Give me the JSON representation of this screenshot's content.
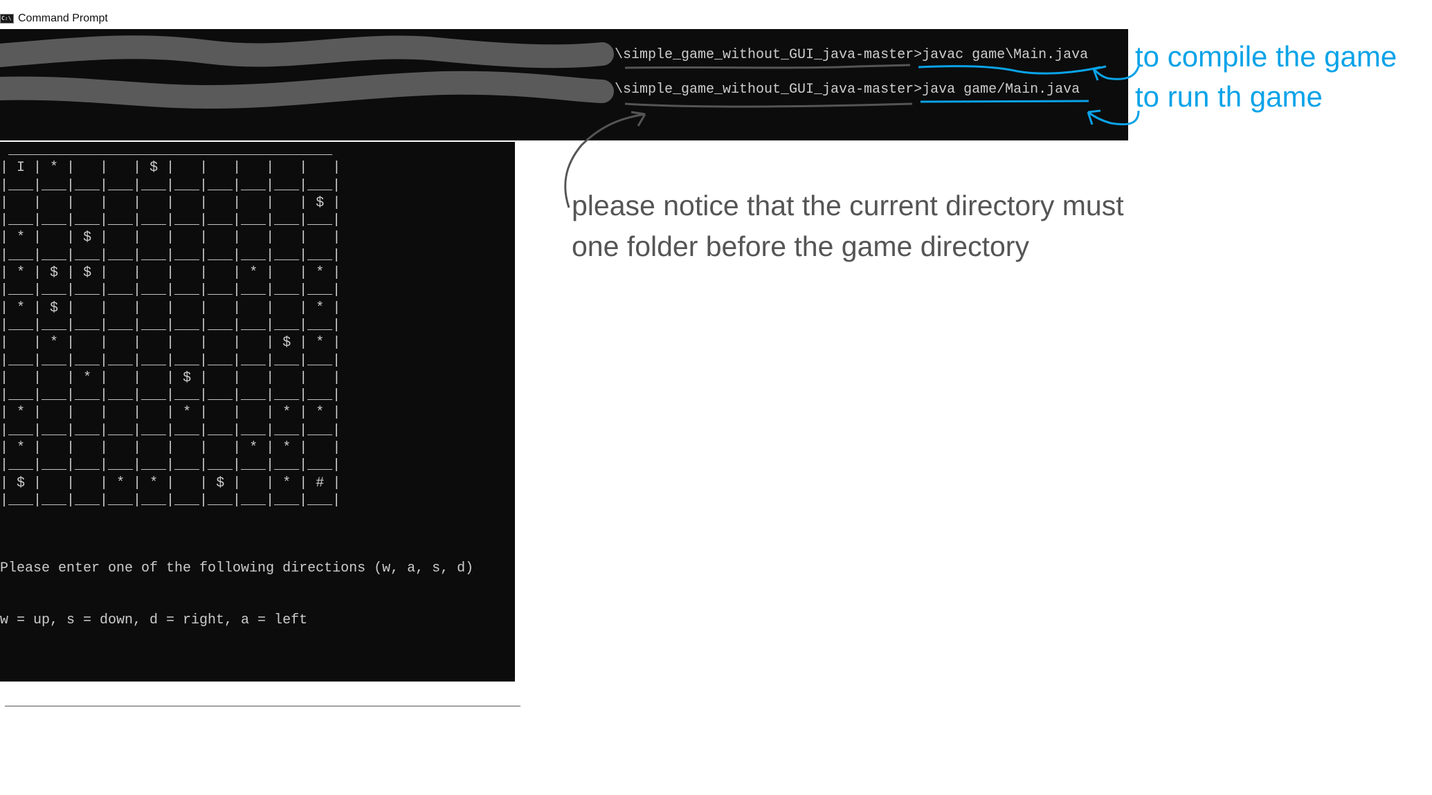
{
  "window": {
    "title": "Command Prompt",
    "icon": "cmd-icon",
    "icon_text": "C:\\"
  },
  "terminal": {
    "commands": [
      {
        "path": "\\simple_game_without_GUI_java-master>",
        "command": "javac game\\Main.java"
      },
      {
        "path": "\\simple_game_without_GUI_java-master>",
        "command": "java game/Main.java"
      }
    ],
    "grid": [
      [
        "I",
        "*",
        " ",
        " ",
        "$",
        " ",
        " ",
        " ",
        " ",
        " "
      ],
      [
        " ",
        " ",
        " ",
        " ",
        " ",
        " ",
        " ",
        " ",
        " ",
        "$"
      ],
      [
        "*",
        " ",
        "$",
        " ",
        " ",
        " ",
        " ",
        " ",
        " ",
        " "
      ],
      [
        "*",
        "$",
        "$",
        " ",
        " ",
        " ",
        " ",
        "*",
        " ",
        "*"
      ],
      [
        "*",
        "$",
        " ",
        " ",
        " ",
        " ",
        " ",
        " ",
        " ",
        "*"
      ],
      [
        " ",
        "*",
        " ",
        " ",
        " ",
        " ",
        " ",
        " ",
        "$",
        "*"
      ],
      [
        " ",
        " ",
        "*",
        " ",
        " ",
        "$",
        " ",
        " ",
        " ",
        " "
      ],
      [
        "*",
        " ",
        " ",
        " ",
        " ",
        "*",
        " ",
        " ",
        "*",
        "*"
      ],
      [
        "*",
        " ",
        " ",
        " ",
        " ",
        " ",
        " ",
        "*",
        "*",
        " "
      ],
      [
        "$",
        " ",
        " ",
        "*",
        "*",
        " ",
        "$",
        " ",
        "*",
        "#"
      ]
    ],
    "prompt_lines": [
      "Please enter one of the following directions (w, a, s, d)",
      "w = up, s = down, d = right, a = left"
    ]
  },
  "annotations": {
    "compile_note": "to compile the game",
    "run_note": "to run th game",
    "directory_note_line1": "please notice that the current directory must",
    "directory_note_line2": "one folder before the game directory",
    "blue": "#0aa3e8",
    "gray": "#555555"
  }
}
